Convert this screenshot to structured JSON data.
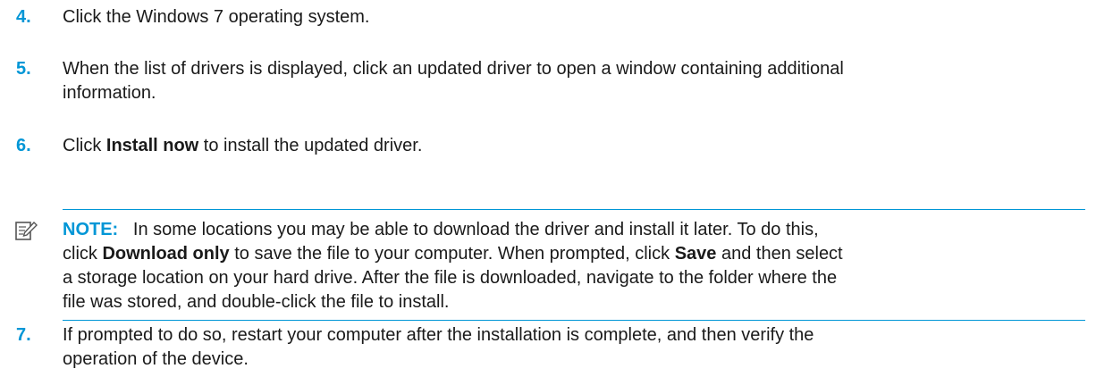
{
  "steps": [
    {
      "num": "4.",
      "text": "Click the Windows 7 operating system."
    },
    {
      "num": "5.",
      "line1": "When the list of drivers is displayed, click an updated driver to open a window containing additional",
      "line2": "information."
    },
    {
      "num": "6.",
      "pre": "Click ",
      "bold": "Install now",
      "post": " to install the updated driver."
    },
    {
      "num": "7.",
      "line1": "If prompted to do so, restart your computer after the installation is complete, and then verify the",
      "line2": "operation of the device."
    }
  ],
  "note": {
    "icon": "note-pencil-icon",
    "label": "NOTE:",
    "t1": "In some locations you may be able to download the driver and install it later. To do this,",
    "t2a": "click ",
    "b1": "Download only",
    "t2b": " to save the file to your computer. When prompted, click ",
    "b2": "Save",
    "t2c": " and then select",
    "t3": "a storage location on your hard drive. After the file is downloaded, navigate to the folder where the",
    "t4": "file was stored, and double-click the file to install."
  },
  "colors": {
    "accent": "#0096d6",
    "text": "#1a1a1a"
  }
}
